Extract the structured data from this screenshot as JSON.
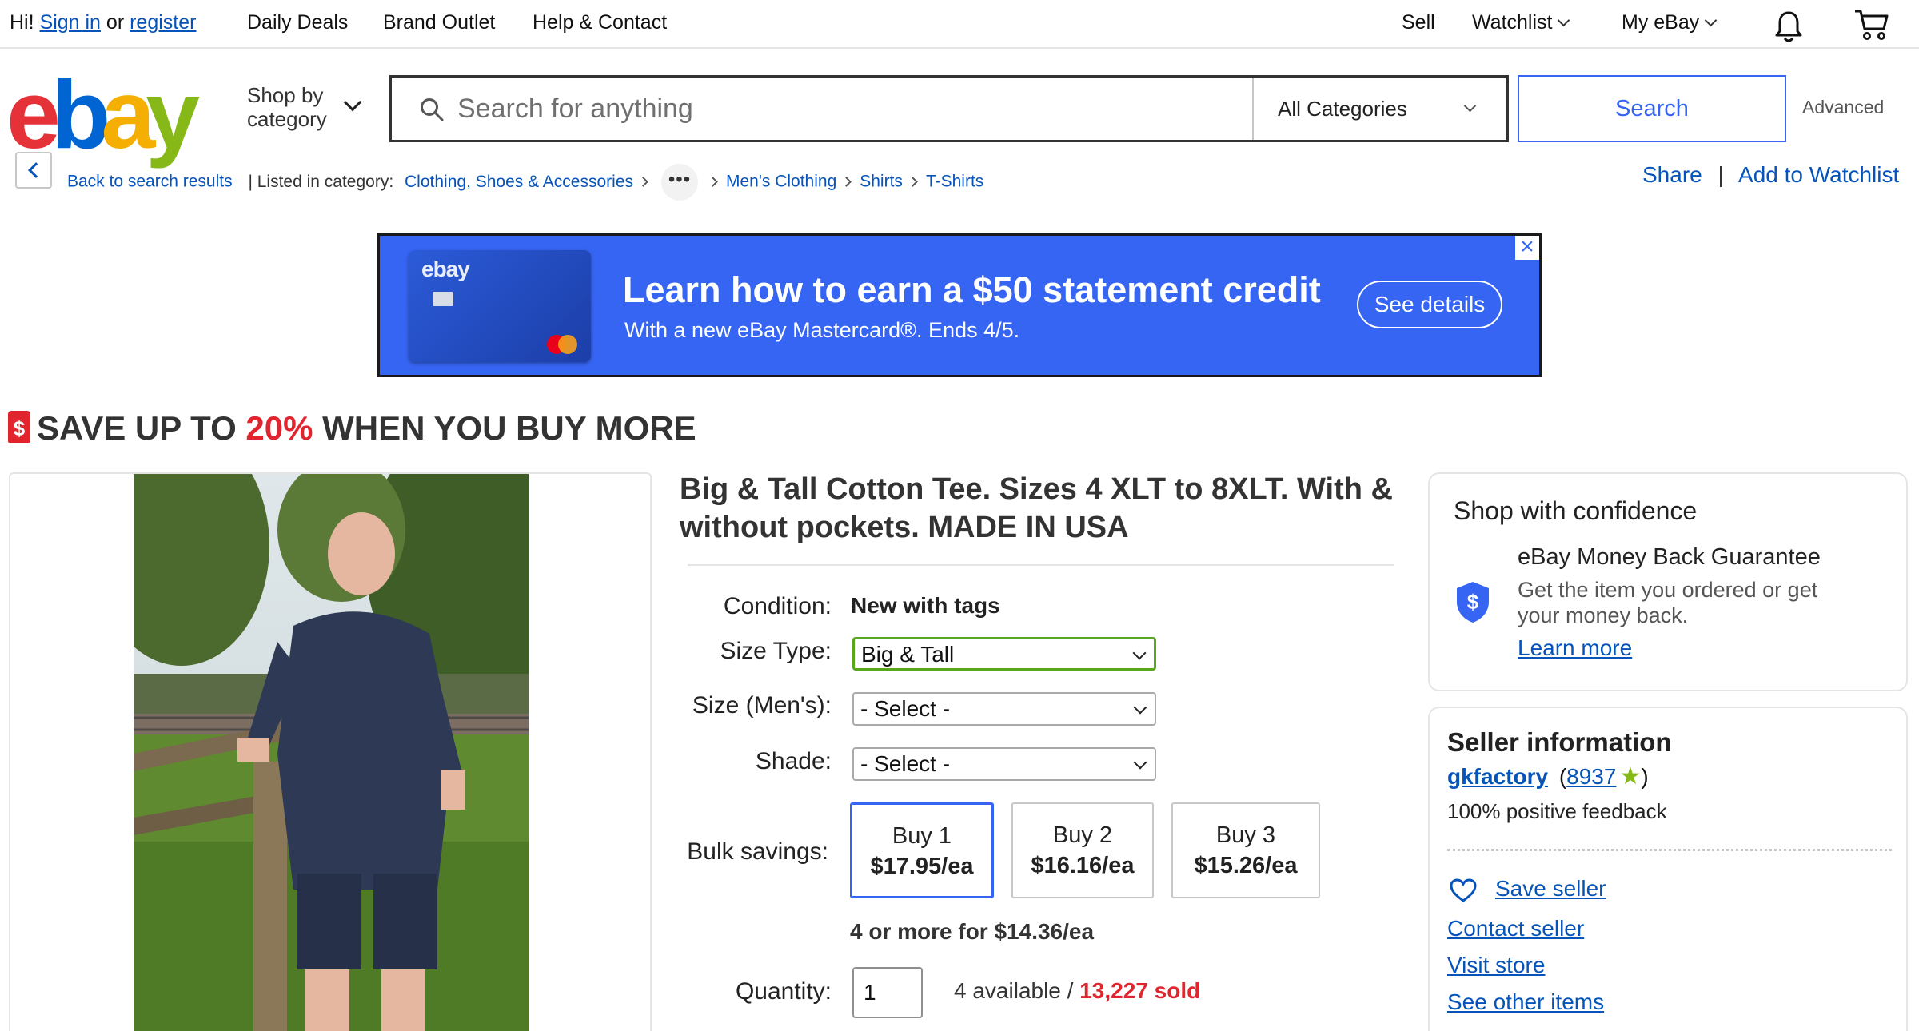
{
  "topbar": {
    "hi": "Hi!",
    "sign_in": "Sign in",
    "or": "or",
    "register": "register",
    "daily_deals": "Daily Deals",
    "brand_outlet": "Brand Outlet",
    "help_contact": "Help & Contact",
    "sell": "Sell",
    "watchlist": "Watchlist",
    "my_ebay": "My eBay"
  },
  "header": {
    "logo_letters": [
      "e",
      "b",
      "a",
      "y"
    ],
    "logo_colors": [
      "#e53238",
      "#0064d2",
      "#f5af02",
      "#86b817"
    ],
    "shop_by_line1": "Shop by",
    "shop_by_line2": "category",
    "search_placeholder": "Search for anything",
    "category_selected": "All Categories",
    "search_button": "Search",
    "advanced": "Advanced"
  },
  "breadcrumb": {
    "back": "Back to search results",
    "listed_in": "| Listed in category:",
    "items": [
      "Clothing, Shoes & Accessories",
      "Men's Clothing",
      "Shirts",
      "T-Shirts"
    ],
    "more": "•••",
    "share": "Share",
    "separator": "|",
    "add_watchlist": "Add to Watchlist"
  },
  "ad": {
    "card_brand": "ebay",
    "title": "Learn how to earn a $50 statement credit",
    "subtitle": "With a new eBay Mastercard®. Ends 4/5.",
    "button": "See details",
    "close": "×"
  },
  "promo": {
    "prefix": "SAVE UP TO ",
    "percent": "20%",
    "suffix": " WHEN YOU BUY MORE",
    "icon_glyph": "$"
  },
  "product": {
    "title": "Big & Tall Cotton Tee. Sizes 4 XLT to 8XLT. With & without pockets. MADE IN USA",
    "condition_label": "Condition:",
    "condition_value": "New with tags",
    "size_type_label": "Size Type:",
    "size_type_value": "Big & Tall",
    "size_label": "Size (Men's):",
    "size_value": "- Select -",
    "shade_label": "Shade:",
    "shade_value": "- Select -",
    "bulk_label": "Bulk savings:",
    "bulk_options": [
      {
        "qty": "Buy 1",
        "price": "$17.95/ea"
      },
      {
        "qty": "Buy 2",
        "price": "$16.16/ea"
      },
      {
        "qty": "Buy 3",
        "price": "$15.26/ea"
      }
    ],
    "four_more": "4 or more for $14.36/ea",
    "quantity_label": "Quantity:",
    "quantity_value": "1",
    "available": "4 available / ",
    "sold": "13,227 sold"
  },
  "confidence": {
    "title": "Shop with confidence",
    "guarantee": "eBay Money Back Guarantee",
    "desc_line1": "Get the item you ordered or get",
    "desc_line2": "your money back.",
    "learn_more": "Learn more",
    "shield_glyph": "$"
  },
  "seller": {
    "title": "Seller information",
    "name": "gkfactory",
    "open_paren": "(",
    "score": "8937",
    "close_paren": ")",
    "feedback": "100% positive feedback",
    "save": "Save seller",
    "contact": "Contact seller",
    "visit": "Visit store",
    "other": "See other items"
  },
  "colors": {
    "link": "#0654ba",
    "accent_blue": "#3665f3",
    "sale_red": "#e0252f",
    "size_type_border": "#5ba71b"
  }
}
